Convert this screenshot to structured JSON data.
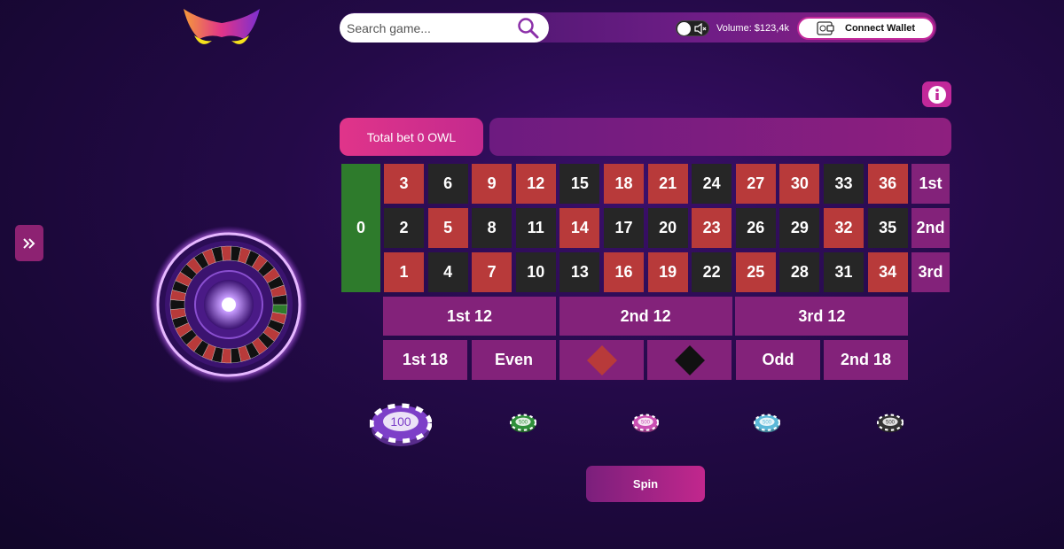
{
  "header": {
    "search_placeholder": "Search game...",
    "volume_text": "Volume: $123,4k",
    "connect_wallet_label": "Connect Wallet"
  },
  "bet": {
    "total_bet_text": "Total bet 0 OWL"
  },
  "table": {
    "zero": "0",
    "rows": [
      [
        "3",
        "6",
        "9",
        "12",
        "15",
        "18",
        "21",
        "24",
        "27",
        "30",
        "33",
        "36"
      ],
      [
        "2",
        "5",
        "8",
        "11",
        "14",
        "17",
        "20",
        "23",
        "26",
        "29",
        "32",
        "35"
      ],
      [
        "1",
        "4",
        "7",
        "10",
        "13",
        "16",
        "19",
        "22",
        "25",
        "28",
        "31",
        "34"
      ]
    ],
    "colors": [
      [
        "red",
        "black",
        "red",
        "red",
        "black",
        "red",
        "red",
        "black",
        "red",
        "red",
        "black",
        "red"
      ],
      [
        "black",
        "red",
        "black",
        "black",
        "red",
        "black",
        "black",
        "red",
        "black",
        "black",
        "red",
        "black"
      ],
      [
        "red",
        "black",
        "red",
        "black",
        "black",
        "red",
        "red",
        "black",
        "red",
        "black",
        "black",
        "red"
      ]
    ],
    "columns": [
      "1st",
      "2nd",
      "3rd"
    ],
    "dozens": [
      "1st 12",
      "2nd 12",
      "3rd 12"
    ],
    "outside": {
      "low": "1st 18",
      "even": "Even",
      "odd": "Odd",
      "high": "2nd 18"
    }
  },
  "chips": [
    {
      "label": "100",
      "color": "#7d3fc8"
    },
    {
      "label": "500",
      "color": "#2f8f3a"
    },
    {
      "label": "500",
      "color": "#c94fb2"
    },
    {
      "label": "500",
      "color": "#5bb8d8"
    },
    {
      "label": "500",
      "color": "#333333"
    }
  ],
  "spin_label": "Spin",
  "colors": {
    "red": "#b83a3a",
    "black": "#262626",
    "green": "#2e7b2c",
    "accent": "#c2289a"
  }
}
